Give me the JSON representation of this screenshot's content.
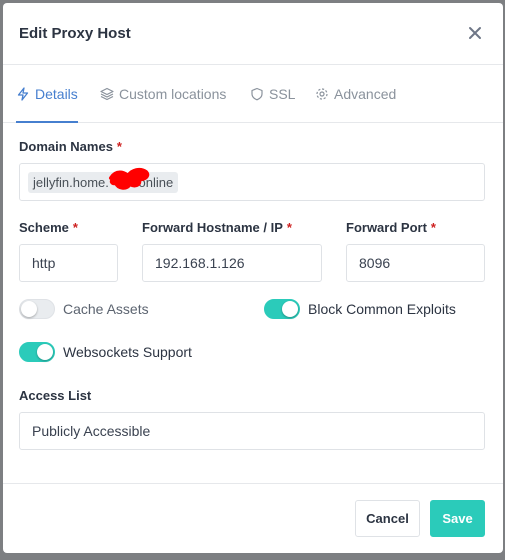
{
  "modal": {
    "title": "Edit Proxy Host"
  },
  "tabs": [
    {
      "label": "Details",
      "icon": "bolt-icon"
    },
    {
      "label": "Custom locations",
      "icon": "layers-icon"
    },
    {
      "label": "SSL",
      "icon": "shield-icon"
    },
    {
      "label": "Advanced",
      "icon": "gear-icon"
    }
  ],
  "form": {
    "domain_names": {
      "label": "Domain Names",
      "required": "*",
      "value": "jellyfin.home.",
      "value_suffix": ".online"
    },
    "scheme": {
      "label": "Scheme",
      "required": "*",
      "value": "http"
    },
    "forward_hostname": {
      "label": "Forward Hostname / IP",
      "required": "*",
      "value": "192.168.1.126"
    },
    "forward_port": {
      "label": "Forward Port",
      "required": "*",
      "value": "8096"
    },
    "cache_assets": {
      "label": "Cache Assets",
      "checked": "false"
    },
    "block_exploits": {
      "label": "Block Common Exploits",
      "checked": "true"
    },
    "websockets": {
      "label": "Websockets Support",
      "checked": "true"
    },
    "access_list": {
      "label": "Access List",
      "value": "Publicly Accessible"
    }
  },
  "footer": {
    "cancel_label": "Cancel",
    "save_label": "Save"
  },
  "colors": {
    "accent": "#467fcf",
    "teal": "#2bcbba",
    "required": "#cd201f",
    "redaction": "#ff0000"
  }
}
